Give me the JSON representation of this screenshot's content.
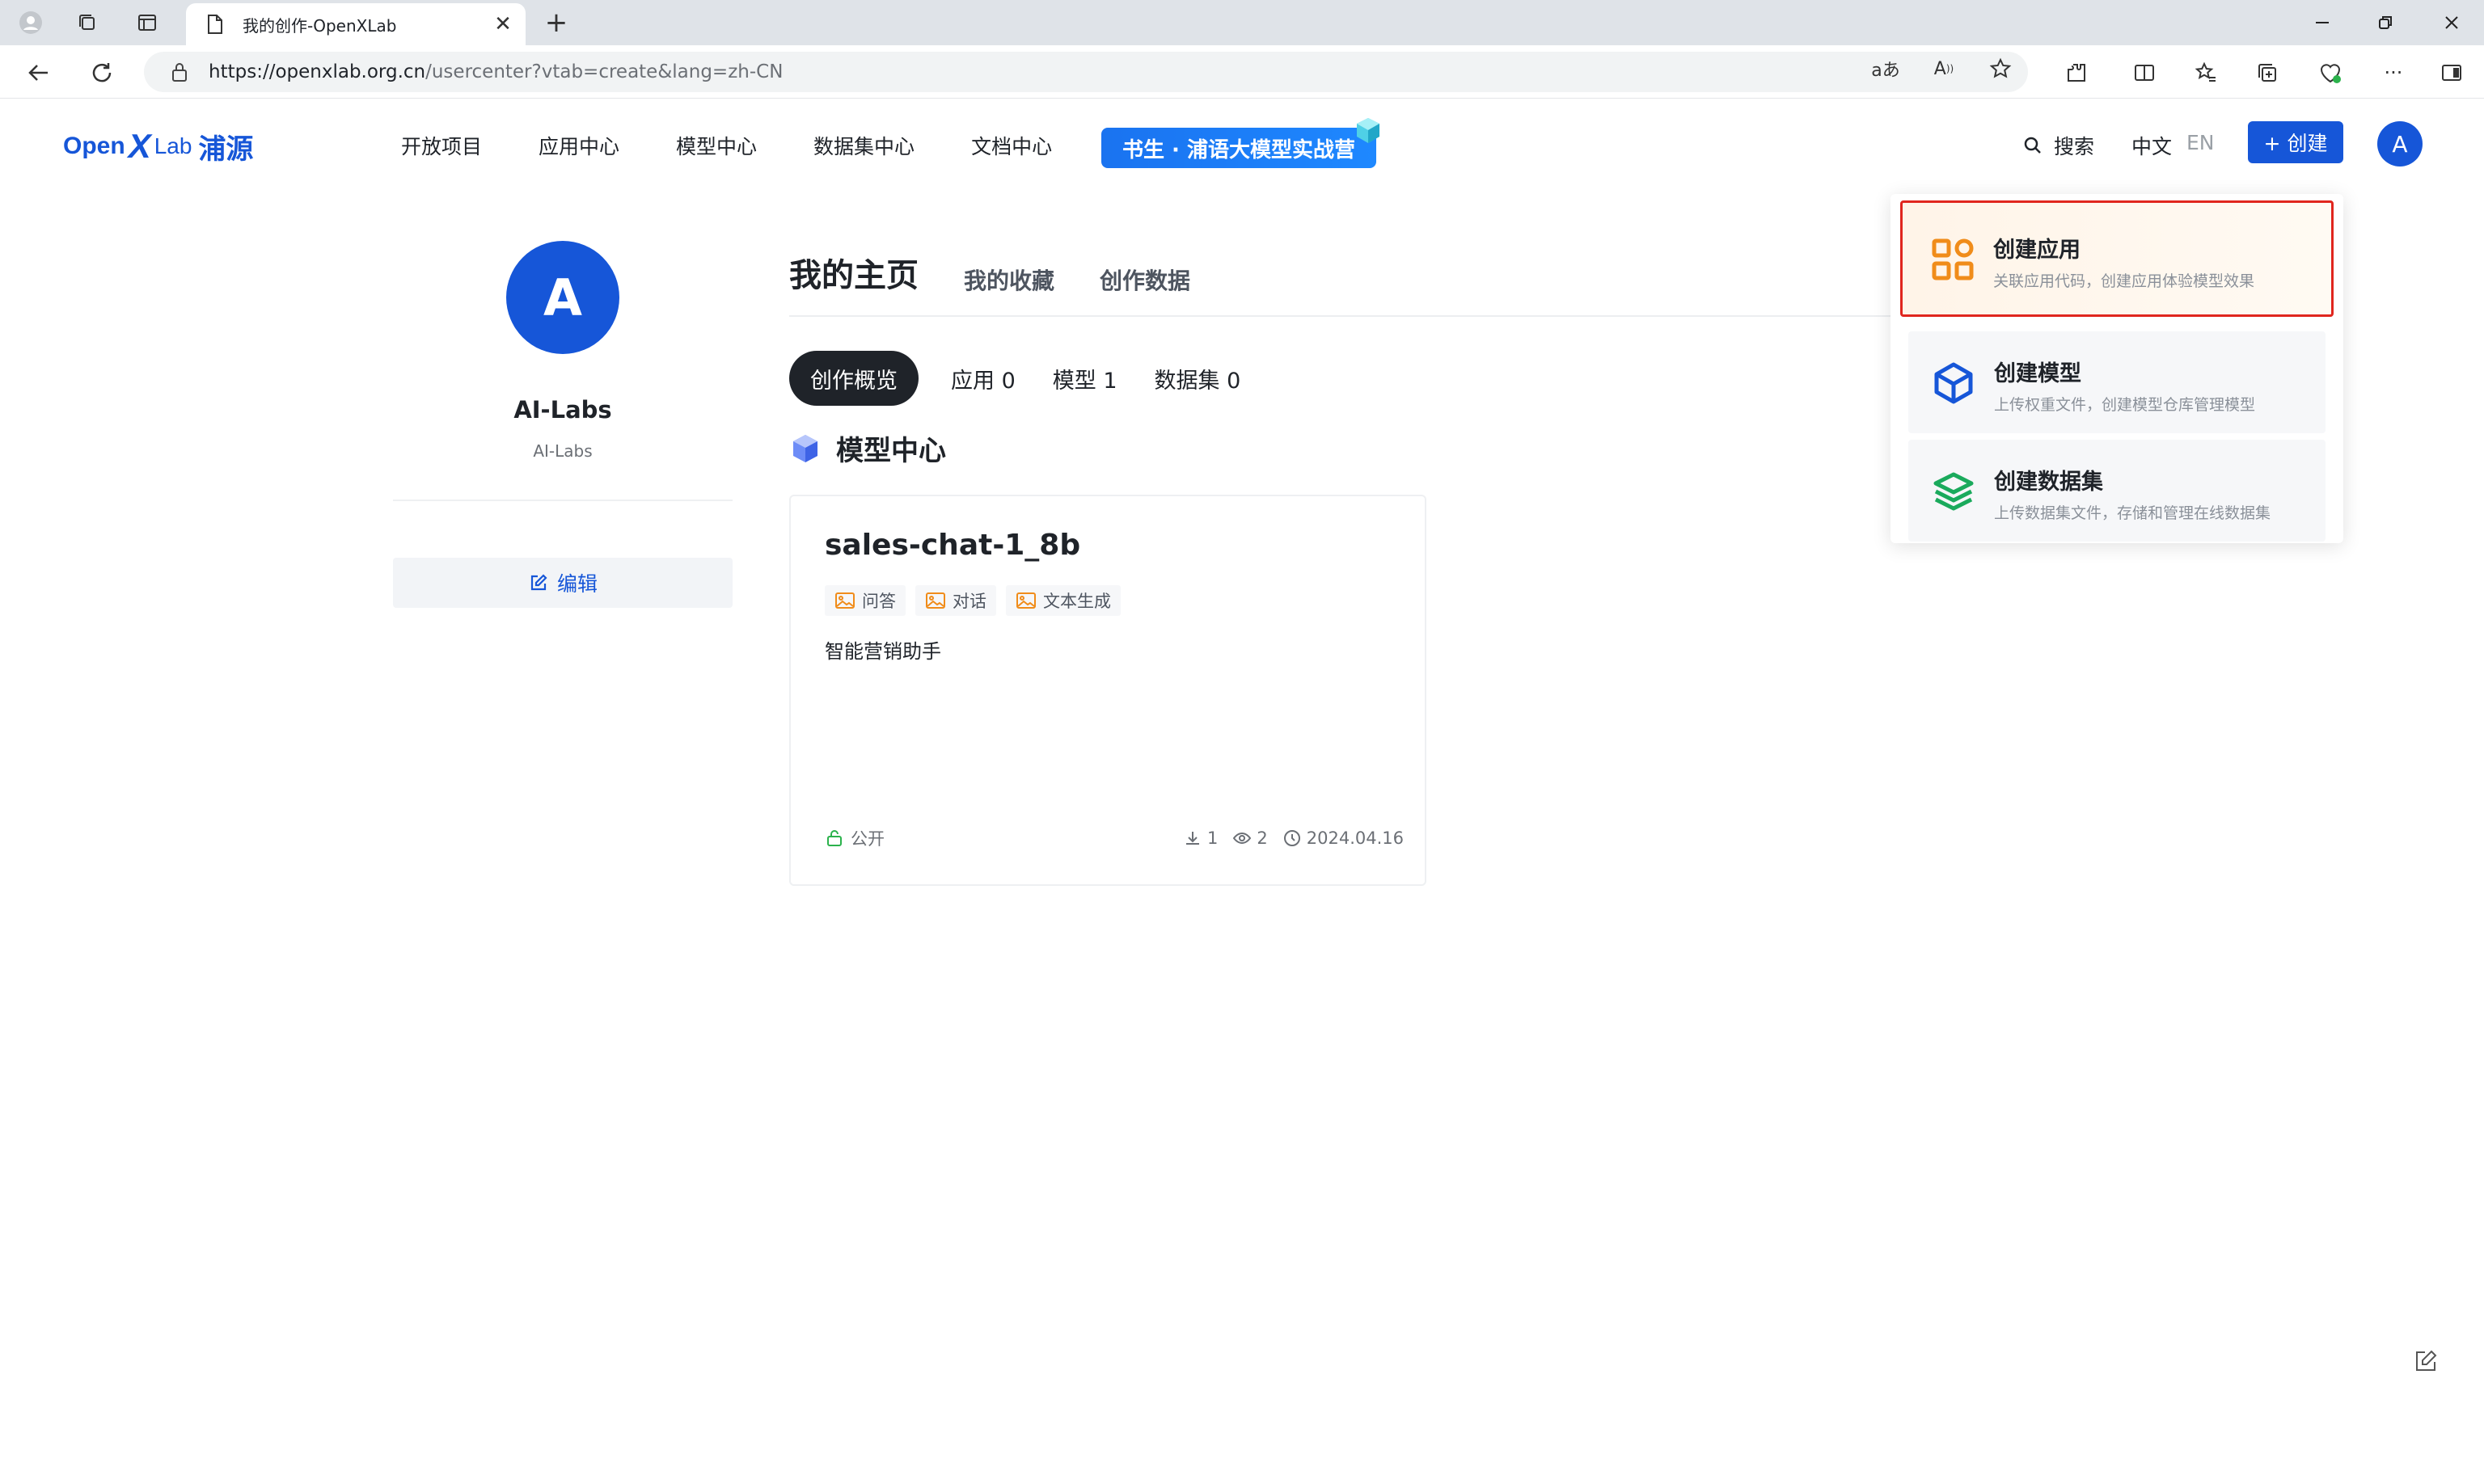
{
  "browser": {
    "tab_title": "我的创作-OpenXLab",
    "tab_close": "✕",
    "new_tab": "+",
    "url_host": "https://openxlab.org.cn",
    "url_rest": "/usercenter?vtab=create&lang=zh-CN"
  },
  "site": {
    "logo_open": "Open",
    "logo_x": "X",
    "logo_lab": "Lab",
    "logo_cn": "浦源",
    "nav": [
      "开放项目",
      "应用中心",
      "模型中心",
      "数据集中心",
      "文档中心"
    ],
    "promo": "书生 · 浦语大模型实战营",
    "search": "搜索",
    "lang_zh": "中文",
    "lang_en": "EN",
    "create": "+  创建",
    "avatar_letter": "A"
  },
  "profile": {
    "avatar_letter": "A",
    "name": "AI-Labs",
    "username": "AI-Labs",
    "edit": "编辑"
  },
  "main_tabs": [
    "我的主页",
    "我的收藏",
    "创作数据"
  ],
  "sub_tabs": [
    "创作概览",
    "应用 0",
    "模型 1",
    "数据集 0"
  ],
  "section_title": "模型中心",
  "model_card": {
    "title": "sales-chat-1_8b",
    "tags": [
      "问答",
      "对话",
      "文本生成"
    ],
    "description": "智能营销助手",
    "visibility": "公开",
    "downloads": "1",
    "views": "2",
    "date": "2024.04.16"
  },
  "dropdown": [
    {
      "title": "创建应用",
      "desc": "关联应用代码，创建应用体验模型效果",
      "icon": "app-grid-icon",
      "color": "#f08c1a"
    },
    {
      "title": "创建模型",
      "desc": "上传权重文件，创建模型仓库管理模型",
      "icon": "model-cube-icon",
      "color": "#1656d8"
    },
    {
      "title": "创建数据集",
      "desc": "上传数据集文件，存储和管理在线数据集",
      "icon": "dataset-layers-icon",
      "color": "#1aaa5c"
    }
  ],
  "colors": {
    "brand": "#1656d8",
    "highlight_border": "#e0261e",
    "tag_icon": "#f08c1a"
  }
}
